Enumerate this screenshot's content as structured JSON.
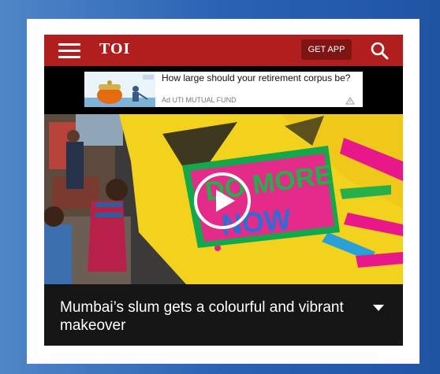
{
  "header": {
    "logo": "TOI",
    "get_app_label": "GET APP",
    "menu_icon": "hamburger-menu-icon",
    "search_icon": "search-icon",
    "brand_color": "#b01e1e"
  },
  "ad": {
    "headline": "How large should your retirement corpus be?",
    "sponsor": "Ad UTI MUTUAL FUND",
    "choice_icon": "ad-choices-icon"
  },
  "video": {
    "play_icon": "play-icon",
    "mural_text": "DO MORE NOW"
  },
  "article": {
    "title": "Mumbai’s slum gets a colourful and vibrant makeover",
    "expand_icon": "chevron-down-icon"
  }
}
